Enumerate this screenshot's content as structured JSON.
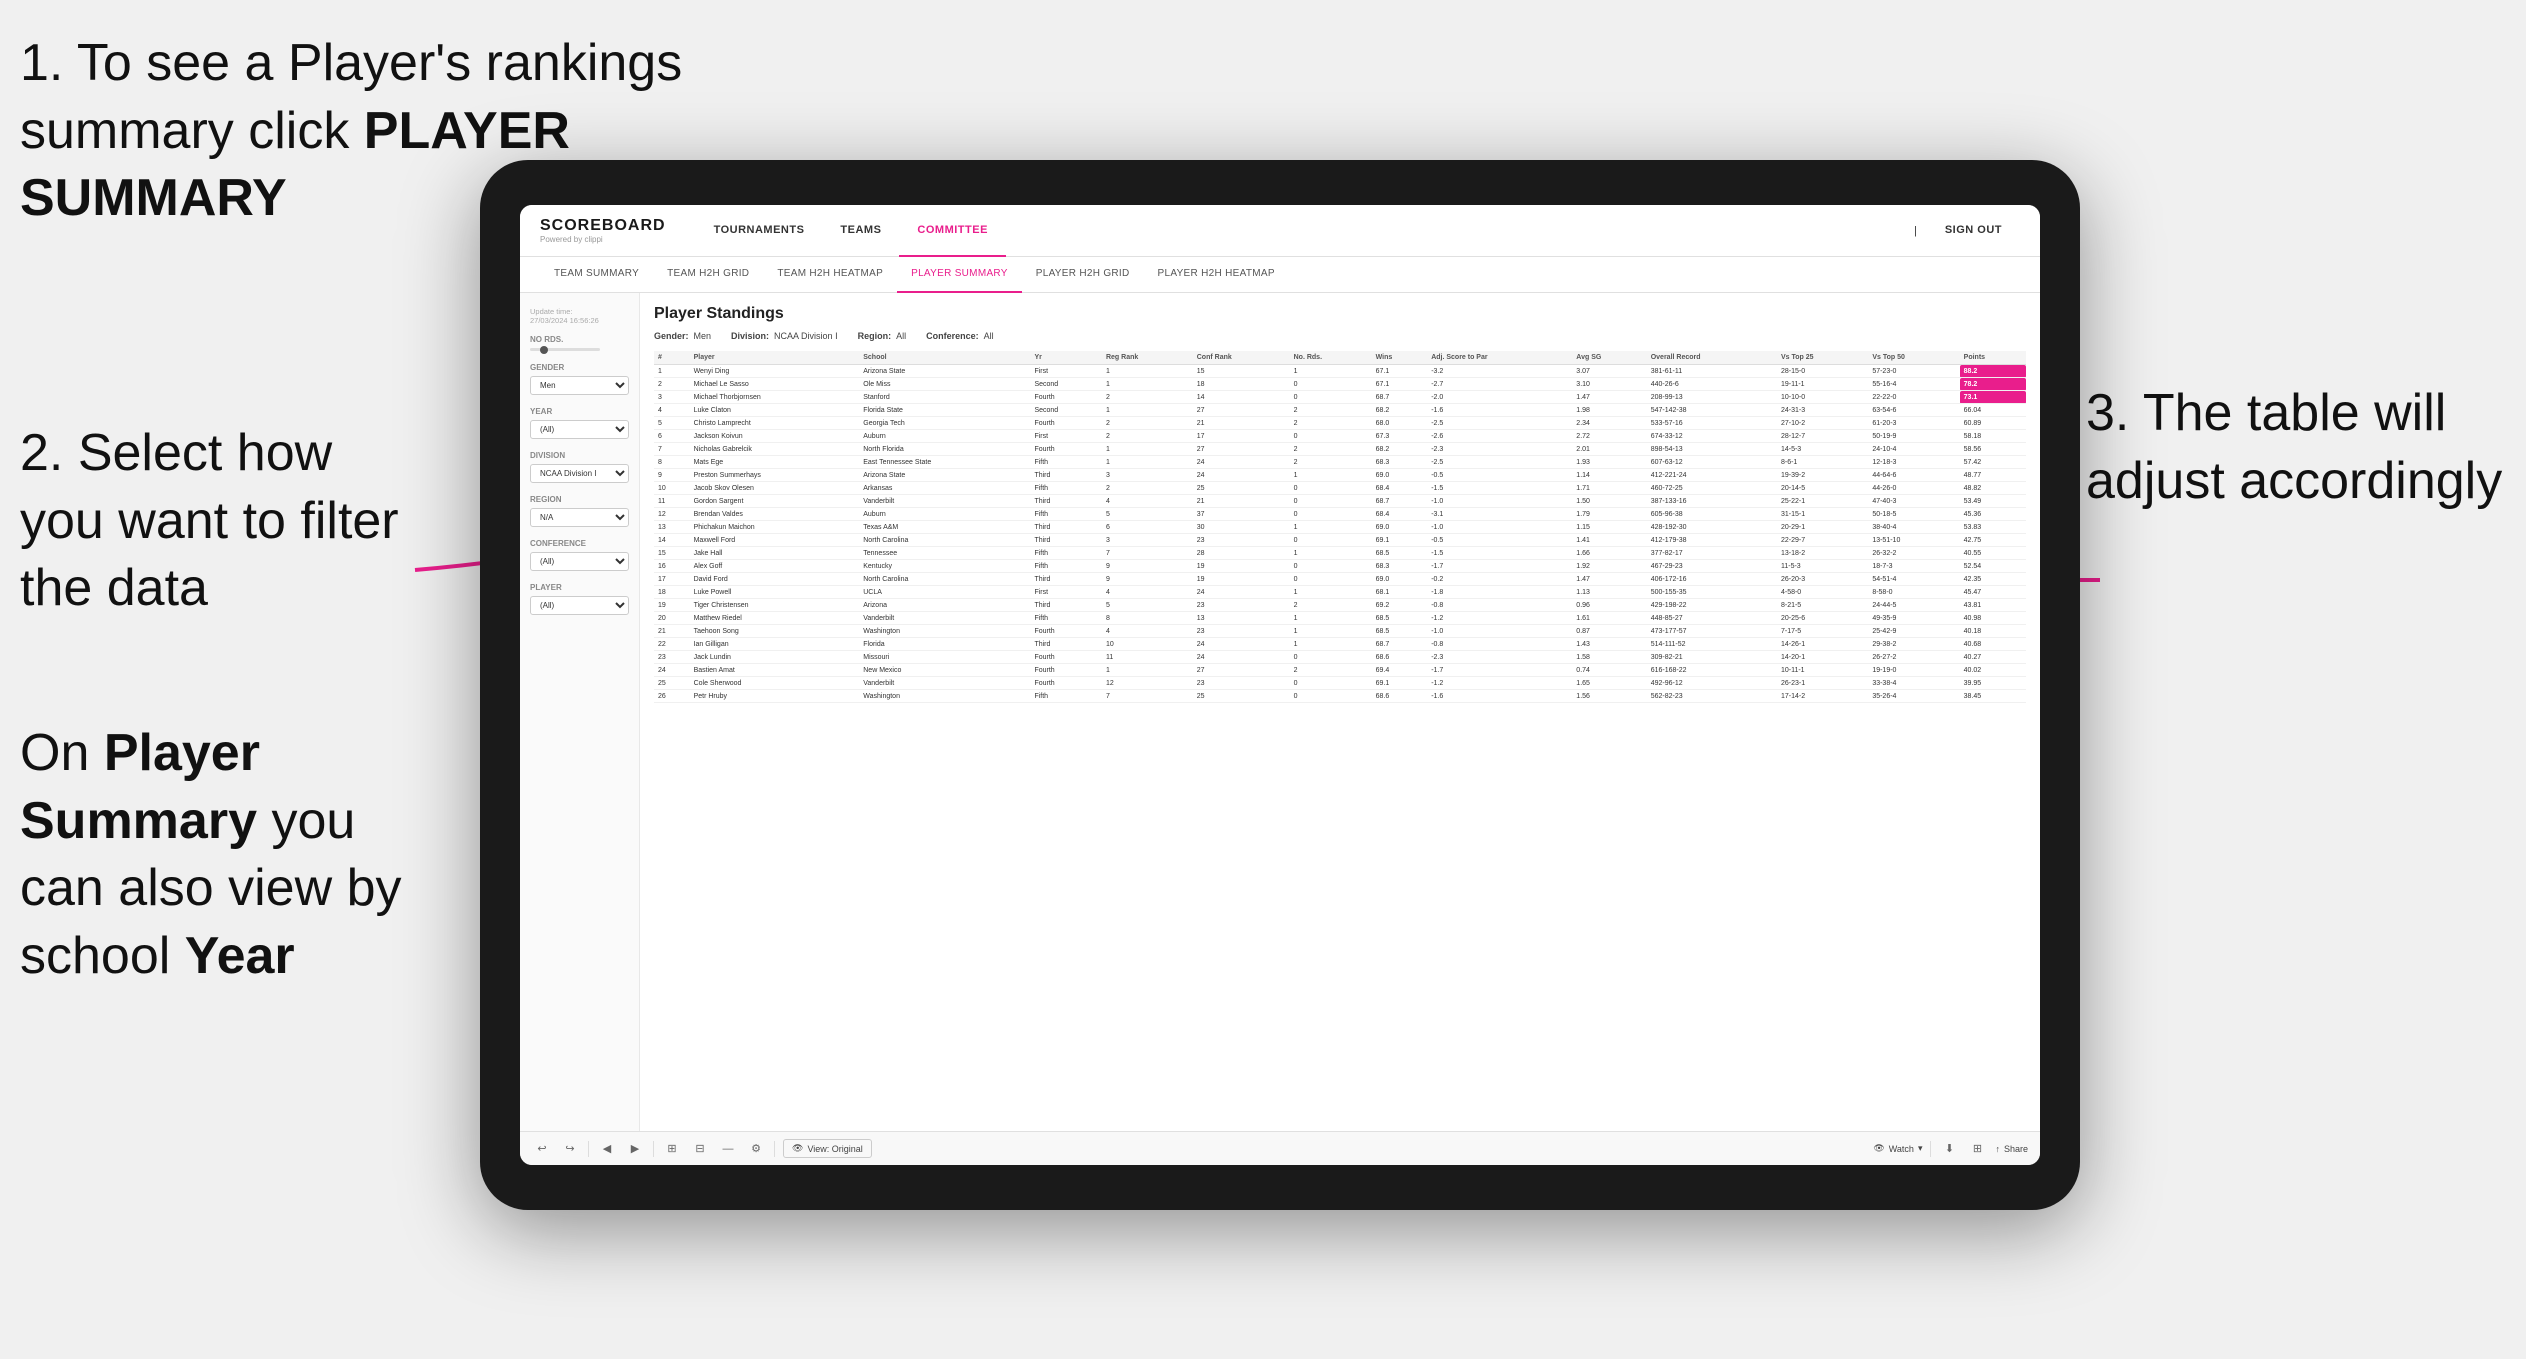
{
  "annotations": {
    "step1": "1. To see a Player's rankings summary click ",
    "step1_bold": "PLAYER SUMMARY",
    "step2_title": "2. Select how you want to filter the data",
    "step3_title": "3. The table will adjust accordingly",
    "step_bottom": "On ",
    "step_bottom_bold1": "Player Summary",
    "step_bottom_mid": " you can also view by school ",
    "step_bottom_bold2": "Year"
  },
  "app": {
    "logo": "SCOREBOARD",
    "logo_sub": "Powered by clippi",
    "sign_out": "Sign out",
    "nav": [
      {
        "label": "TOURNAMENTS",
        "active": false
      },
      {
        "label": "TEAMS",
        "active": false
      },
      {
        "label": "COMMITTEE",
        "active": true
      }
    ],
    "sub_nav": [
      {
        "label": "TEAM SUMMARY",
        "active": false
      },
      {
        "label": "TEAM H2H GRID",
        "active": false
      },
      {
        "label": "TEAM H2H HEATMAP",
        "active": false
      },
      {
        "label": "PLAYER SUMMARY",
        "active": true
      },
      {
        "label": "PLAYER H2H GRID",
        "active": false
      },
      {
        "label": "PLAYER H2H HEATMAP",
        "active": false
      }
    ]
  },
  "sidebar": {
    "update_label": "Update time:",
    "update_time": "27/03/2024 16:56:26",
    "no_rds_label": "No Rds.",
    "gender_label": "Gender",
    "gender_value": "Men",
    "year_label": "Year",
    "year_value": "(All)",
    "division_label": "Division",
    "division_value": "NCAA Division I",
    "region_label": "Region",
    "region_value": "N/A",
    "conference_label": "Conference",
    "conference_value": "(All)",
    "player_label": "Player",
    "player_value": "(All)"
  },
  "table": {
    "title": "Player Standings",
    "gender_label": "Gender:",
    "gender_value": "Men",
    "division_label": "Division:",
    "division_value": "NCAA Division I",
    "region_label": "Region:",
    "region_value": "All",
    "conference_label": "Conference:",
    "conference_value": "All",
    "columns": [
      "#",
      "Player",
      "School",
      "Yr",
      "Reg Rank",
      "Conf Rank",
      "No. Rds.",
      "Wins",
      "Adj. Score to Par",
      "Avg SG",
      "Overall Record",
      "Vs Top 25",
      "Vs Top 50",
      "Points"
    ],
    "rows": [
      {
        "rank": "1",
        "player": "Wenyi Ding",
        "school": "Arizona State",
        "yr": "First",
        "reg_rank": "1",
        "conf_rank": "15",
        "no_rds": "1",
        "wins": "67.1",
        "adj": "-3.2",
        "avg_sg": "3.07",
        "record": "381-61-11",
        "vt25": "28-15-0",
        "vt50": "57-23-0",
        "points": "88.2"
      },
      {
        "rank": "2",
        "player": "Michael Le Sasso",
        "school": "Ole Miss",
        "yr": "Second",
        "reg_rank": "1",
        "conf_rank": "18",
        "no_rds": "0",
        "wins": "67.1",
        "adj": "-2.7",
        "avg_sg": "3.10",
        "record": "440-26-6",
        "vt25": "19-11-1",
        "vt50": "55-16-4",
        "points": "78.2"
      },
      {
        "rank": "3",
        "player": "Michael Thorbjornsen",
        "school": "Stanford",
        "yr": "Fourth",
        "reg_rank": "2",
        "conf_rank": "14",
        "no_rds": "0",
        "wins": "68.7",
        "adj": "-2.0",
        "avg_sg": "1.47",
        "record": "208-99-13",
        "vt25": "10-10-0",
        "vt50": "22-22-0",
        "points": "73.1"
      },
      {
        "rank": "4",
        "player": "Luke Claton",
        "school": "Florida State",
        "yr": "Second",
        "reg_rank": "1",
        "conf_rank": "27",
        "no_rds": "2",
        "wins": "68.2",
        "adj": "-1.6",
        "avg_sg": "1.98",
        "record": "547-142-38",
        "vt25": "24-31-3",
        "vt50": "63-54-6",
        "points": "66.04"
      },
      {
        "rank": "5",
        "player": "Christo Lamprecht",
        "school": "Georgia Tech",
        "yr": "Fourth",
        "reg_rank": "2",
        "conf_rank": "21",
        "no_rds": "2",
        "wins": "68.0",
        "adj": "-2.5",
        "avg_sg": "2.34",
        "record": "533-57-16",
        "vt25": "27-10-2",
        "vt50": "61-20-3",
        "points": "60.89"
      },
      {
        "rank": "6",
        "player": "Jackson Koivun",
        "school": "Auburn",
        "yr": "First",
        "reg_rank": "2",
        "conf_rank": "17",
        "no_rds": "0",
        "wins": "67.3",
        "adj": "-2.6",
        "avg_sg": "2.72",
        "record": "674-33-12",
        "vt25": "28-12-7",
        "vt50": "50-19-9",
        "points": "58.18"
      },
      {
        "rank": "7",
        "player": "Nicholas Gabrelcik",
        "school": "North Florida",
        "yr": "Fourth",
        "reg_rank": "1",
        "conf_rank": "27",
        "no_rds": "2",
        "wins": "68.2",
        "adj": "-2.3",
        "avg_sg": "2.01",
        "record": "898-54-13",
        "vt25": "14-5-3",
        "vt50": "24-10-4",
        "points": "58.56"
      },
      {
        "rank": "8",
        "player": "Mats Ege",
        "school": "East Tennessee State",
        "yr": "Fifth",
        "reg_rank": "1",
        "conf_rank": "24",
        "no_rds": "2",
        "wins": "68.3",
        "adj": "-2.5",
        "avg_sg": "1.93",
        "record": "607-63-12",
        "vt25": "8-6-1",
        "vt50": "12-18-3",
        "points": "57.42"
      },
      {
        "rank": "9",
        "player": "Preston Summerhays",
        "school": "Arizona State",
        "yr": "Third",
        "reg_rank": "3",
        "conf_rank": "24",
        "no_rds": "1",
        "wins": "69.0",
        "adj": "-0.5",
        "avg_sg": "1.14",
        "record": "412-221-24",
        "vt25": "19-39-2",
        "vt50": "44-64-6",
        "points": "48.77"
      },
      {
        "rank": "10",
        "player": "Jacob Skov Olesen",
        "school": "Arkansas",
        "yr": "Fifth",
        "reg_rank": "2",
        "conf_rank": "25",
        "no_rds": "0",
        "wins": "68.4",
        "adj": "-1.5",
        "avg_sg": "1.71",
        "record": "460-72-25",
        "vt25": "20-14-5",
        "vt50": "44-26-0",
        "points": "48.82"
      },
      {
        "rank": "11",
        "player": "Gordon Sargent",
        "school": "Vanderbilt",
        "yr": "Third",
        "reg_rank": "4",
        "conf_rank": "21",
        "no_rds": "0",
        "wins": "68.7",
        "adj": "-1.0",
        "avg_sg": "1.50",
        "record": "387-133-16",
        "vt25": "25-22-1",
        "vt50": "47-40-3",
        "points": "53.49"
      },
      {
        "rank": "12",
        "player": "Brendan Valdes",
        "school": "Auburn",
        "yr": "Fifth",
        "reg_rank": "5",
        "conf_rank": "37",
        "no_rds": "0",
        "wins": "68.4",
        "adj": "-3.1",
        "avg_sg": "1.79",
        "record": "605-96-38",
        "vt25": "31-15-1",
        "vt50": "50-18-5",
        "points": "45.36"
      },
      {
        "rank": "13",
        "player": "Phichakun Maichon",
        "school": "Texas A&M",
        "yr": "Third",
        "reg_rank": "6",
        "conf_rank": "30",
        "no_rds": "1",
        "wins": "69.0",
        "adj": "-1.0",
        "avg_sg": "1.15",
        "record": "428-192-30",
        "vt25": "20-29-1",
        "vt50": "38-40-4",
        "points": "53.83"
      },
      {
        "rank": "14",
        "player": "Maxwell Ford",
        "school": "North Carolina",
        "yr": "Third",
        "reg_rank": "3",
        "conf_rank": "23",
        "no_rds": "0",
        "wins": "69.1",
        "adj": "-0.5",
        "avg_sg": "1.41",
        "record": "412-179-38",
        "vt25": "22-29-7",
        "vt50": "13-51-10",
        "points": "42.75"
      },
      {
        "rank": "15",
        "player": "Jake Hall",
        "school": "Tennessee",
        "yr": "Fifth",
        "reg_rank": "7",
        "conf_rank": "28",
        "no_rds": "1",
        "wins": "68.5",
        "adj": "-1.5",
        "avg_sg": "1.66",
        "record": "377-82-17",
        "vt25": "13-18-2",
        "vt50": "26-32-2",
        "points": "40.55"
      },
      {
        "rank": "16",
        "player": "Alex Goff",
        "school": "Kentucky",
        "yr": "Fifth",
        "reg_rank": "9",
        "conf_rank": "19",
        "no_rds": "0",
        "wins": "68.3",
        "adj": "-1.7",
        "avg_sg": "1.92",
        "record": "467-29-23",
        "vt25": "11-5-3",
        "vt50": "18-7-3",
        "points": "52.54"
      },
      {
        "rank": "17",
        "player": "David Ford",
        "school": "North Carolina",
        "yr": "Third",
        "reg_rank": "9",
        "conf_rank": "19",
        "no_rds": "0",
        "wins": "69.0",
        "adj": "-0.2",
        "avg_sg": "1.47",
        "record": "406-172-16",
        "vt25": "26-20-3",
        "vt50": "54-51-4",
        "points": "42.35"
      },
      {
        "rank": "18",
        "player": "Luke Powell",
        "school": "UCLA",
        "yr": "First",
        "reg_rank": "4",
        "conf_rank": "24",
        "no_rds": "1",
        "wins": "68.1",
        "adj": "-1.8",
        "avg_sg": "1.13",
        "record": "500-155-35",
        "vt25": "4-58-0",
        "vt50": "8-58-0",
        "points": "45.47"
      },
      {
        "rank": "19",
        "player": "Tiger Christensen",
        "school": "Arizona",
        "yr": "Third",
        "reg_rank": "5",
        "conf_rank": "23",
        "no_rds": "2",
        "wins": "69.2",
        "adj": "-0.8",
        "avg_sg": "0.96",
        "record": "429-198-22",
        "vt25": "8-21-5",
        "vt50": "24-44-5",
        "points": "43.81"
      },
      {
        "rank": "20",
        "player": "Matthew Riedel",
        "school": "Vanderbilt",
        "yr": "Fifth",
        "reg_rank": "8",
        "conf_rank": "13",
        "no_rds": "1",
        "wins": "68.5",
        "adj": "-1.2",
        "avg_sg": "1.61",
        "record": "448-85-27",
        "vt25": "20-25-6",
        "vt50": "49-35-9",
        "points": "40.98"
      },
      {
        "rank": "21",
        "player": "Taehoon Song",
        "school": "Washington",
        "yr": "Fourth",
        "reg_rank": "4",
        "conf_rank": "23",
        "no_rds": "1",
        "wins": "68.5",
        "adj": "-1.0",
        "avg_sg": "0.87",
        "record": "473-177-57",
        "vt25": "7-17-5",
        "vt50": "25-42-9",
        "points": "40.18"
      },
      {
        "rank": "22",
        "player": "Ian Gilligan",
        "school": "Florida",
        "yr": "Third",
        "reg_rank": "10",
        "conf_rank": "24",
        "no_rds": "1",
        "wins": "68.7",
        "adj": "-0.8",
        "avg_sg": "1.43",
        "record": "514-111-52",
        "vt25": "14-26-1",
        "vt50": "29-38-2",
        "points": "40.68"
      },
      {
        "rank": "23",
        "player": "Jack Lundin",
        "school": "Missouri",
        "yr": "Fourth",
        "reg_rank": "11",
        "conf_rank": "24",
        "no_rds": "0",
        "wins": "68.6",
        "adj": "-2.3",
        "avg_sg": "1.58",
        "record": "309-82-21",
        "vt25": "14-20-1",
        "vt50": "26-27-2",
        "points": "40.27"
      },
      {
        "rank": "24",
        "player": "Bastien Amat",
        "school": "New Mexico",
        "yr": "Fourth",
        "reg_rank": "1",
        "conf_rank": "27",
        "no_rds": "2",
        "wins": "69.4",
        "adj": "-1.7",
        "avg_sg": "0.74",
        "record": "616-168-22",
        "vt25": "10-11-1",
        "vt50": "19-19-0",
        "points": "40.02"
      },
      {
        "rank": "25",
        "player": "Cole Sherwood",
        "school": "Vanderbilt",
        "yr": "Fourth",
        "reg_rank": "12",
        "conf_rank": "23",
        "no_rds": "0",
        "wins": "69.1",
        "adj": "-1.2",
        "avg_sg": "1.65",
        "record": "492-96-12",
        "vt25": "26-23-1",
        "vt50": "33-38-4",
        "points": "39.95"
      },
      {
        "rank": "26",
        "player": "Petr Hruby",
        "school": "Washington",
        "yr": "Fifth",
        "reg_rank": "7",
        "conf_rank": "25",
        "no_rds": "0",
        "wins": "68.6",
        "adj": "-1.6",
        "avg_sg": "1.56",
        "record": "562-82-23",
        "vt25": "17-14-2",
        "vt50": "35-26-4",
        "points": "38.45"
      }
    ]
  },
  "toolbar": {
    "undo": "↩",
    "redo": "↪",
    "back": "◀",
    "forward": "▶",
    "copy": "⊞",
    "paste": "⊟",
    "settings": "⚙",
    "view_label": "View: Original",
    "watch_label": "Watch",
    "share_label": "Share"
  }
}
